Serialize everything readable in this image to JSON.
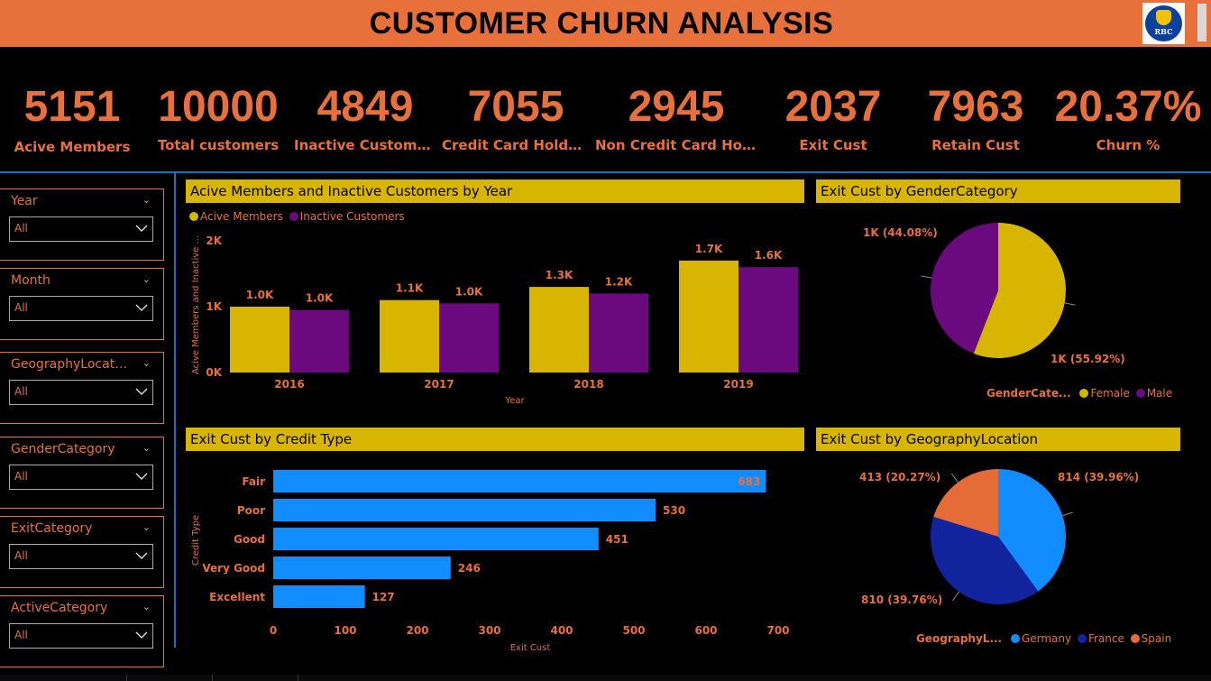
{
  "header": {
    "title": "CUSTOMER CHURN ANALYSIS",
    "logo_text": "RBC"
  },
  "kpis": [
    {
      "value": "5151",
      "label": "Acive Members"
    },
    {
      "value": "10000",
      "label": "Total customers"
    },
    {
      "value": "4849",
      "label": "Inactive Customers"
    },
    {
      "value": "7055",
      "label": "Credit Card Holders"
    },
    {
      "value": "2945",
      "label": "Non Credit Card Hol..."
    },
    {
      "value": "2037",
      "label": "Exit Cust"
    },
    {
      "value": "7963",
      "label": "Retain Cust"
    },
    {
      "value": "20.37%",
      "label": "Churn %"
    }
  ],
  "slicers": [
    {
      "title": "Year",
      "value": "All"
    },
    {
      "title": "Month",
      "value": "All"
    },
    {
      "title": "GeographyLocati...",
      "value": "All"
    },
    {
      "title": "GenderCategory",
      "value": "All"
    },
    {
      "title": "ExitCategory",
      "value": "All"
    },
    {
      "title": "ActiveCategory",
      "value": "All"
    }
  ],
  "colors": {
    "accent": "#e8703a",
    "title_bar": "#d8b500",
    "active": "#d8b500",
    "inactive": "#6b0a7e",
    "credit_bar": "#118dff",
    "germany": "#118dff",
    "france": "#12239e",
    "spain": "#e66c37",
    "female": "#d8b500",
    "male": "#6b0a7e",
    "divider": "#1b6fbf"
  },
  "chart_data": [
    {
      "type": "bar",
      "title": "Acive Members and Inactive Customers by Year",
      "xlabel": "Year",
      "ylabel": "Acive Members and Inactive ...",
      "categories": [
        "2016",
        "2017",
        "2018",
        "2019"
      ],
      "series": [
        {
          "name": "Acive Members",
          "values": [
            1000,
            1100,
            1300,
            1700
          ],
          "labels": [
            "1.0K",
            "1.1K",
            "1.3K",
            "1.7K"
          ]
        },
        {
          "name": "Inactive Customers",
          "values": [
            950,
            1050,
            1200,
            1600
          ],
          "labels": [
            "1.0K",
            "1.0K",
            "1.2K",
            "1.6K"
          ]
        }
      ],
      "yticks": [
        "0K",
        "1K",
        "2K"
      ],
      "ylim": [
        0,
        2000
      ],
      "legend": "top-left"
    },
    {
      "type": "pie",
      "title": "Exit Cust by GenderCategory",
      "legend_title": "GenderCate...",
      "slices": [
        {
          "name": "Female",
          "value": 55.92,
          "label": "1K (55.92%)"
        },
        {
          "name": "Male",
          "value": 44.08,
          "label": "1K (44.08%)"
        }
      ],
      "legend": "bottom-right"
    },
    {
      "type": "bar",
      "orientation": "horizontal",
      "title": "Exit Cust by Credit Type",
      "xlabel": "Exit Cust",
      "ylabel": "Credit Type",
      "categories": [
        "Fair",
        "Poor",
        "Good",
        "Very Good",
        "Excellent"
      ],
      "values": [
        683,
        530,
        451,
        246,
        127
      ],
      "xticks": [
        "0",
        "100",
        "200",
        "300",
        "400",
        "500",
        "600",
        "700"
      ],
      "xlim": [
        0,
        700
      ]
    },
    {
      "type": "pie",
      "title": "Exit Cust by GeographyLocation",
      "legend_title": "GeographyL...",
      "slices": [
        {
          "name": "Germany",
          "value": 39.96,
          "label": "814 (39.96%)"
        },
        {
          "name": "France",
          "value": 39.76,
          "label": "810 (39.76%)"
        },
        {
          "name": "Spain",
          "value": 20.27,
          "label": "413 (20.27%)"
        }
      ],
      "legend": "bottom-right"
    }
  ]
}
